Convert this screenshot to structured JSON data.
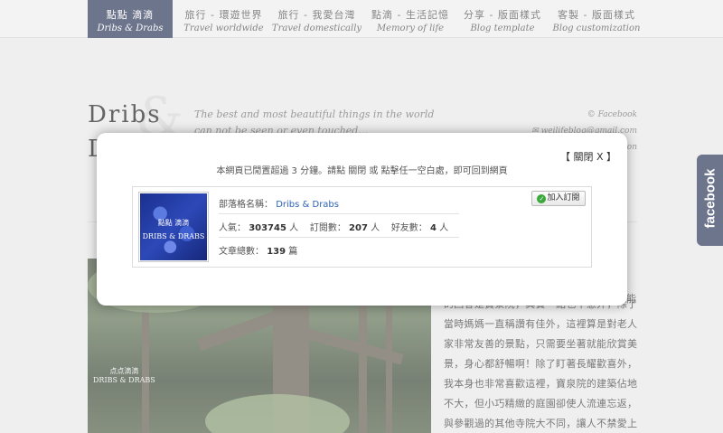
{
  "nav": {
    "items": [
      {
        "zh": "點點 滴滴",
        "en": "Dribs & Drabs"
      },
      {
        "zh": "旅行 - 環遊世界",
        "en": "Travel worldwide"
      },
      {
        "zh": "旅行 - 我愛台灣",
        "en": "Travel domestically"
      },
      {
        "zh": "點滴 - 生活記憶",
        "en": "Memory of life"
      },
      {
        "zh": "分享 - 版面樣式",
        "en": "Blog template"
      },
      {
        "zh": "客製 - 版面樣式",
        "en": "Blog customization"
      }
    ]
  },
  "header": {
    "logo_line1": "Dribs",
    "logo_amp": "&",
    "logo_line2": "D",
    "tagline1": "The best and most beautiful things in the world",
    "tagline2": "can not be seen or even touched...",
    "facebook_link": "© Facebook",
    "email_link": "✉ weilifeblog@gmail.com",
    "third_link": "on"
  },
  "photo": {
    "caption1": "点点滴滴",
    "caption2": "DRIBS & DRABS"
  },
  "article": {
    "text": "的回答是寶景院，其實一點也不意外，除了當時媽媽一直稱讚有佳外，這裡算是對老人家非常友善的景點，只需要坐著就能欣賞美景，身心都舒暢啊！除了盯著長耀歡喜外，我本身也非常喜歡這裡，寶泉院的建築佔地不大，但小巧精緻的庭園卻使人流連忘返，與參觀過的其他寺院大不同，讓人不禁愛上這裡■",
    "edge_char": "能"
  },
  "modal": {
    "close_label": "【 關閉 X 】",
    "message": "本網頁已閒置超過 3 分鐘。請點 關閉 或 點擊任一空白處，即可回到網頁",
    "blog": {
      "name_label": "部落格名稱：",
      "name_value": "Dribs & Drabs",
      "popularity_label": "人氣：",
      "popularity_value": "303745",
      "popularity_unit": "人",
      "subscribers_label": "訂閱數：",
      "subscribers_value": "207",
      "subscribers_unit": "人",
      "friends_label": "好友數：",
      "friends_value": "4",
      "friends_unit": "人",
      "articles_label": "文章總數：",
      "articles_value": "139",
      "articles_unit": "篇",
      "subscribe_label": "加入訂閱",
      "thumb_line1": "點點 滴滴",
      "thumb_line2": "DRIBS & DRABS"
    }
  },
  "facebook_tab": "facebook",
  "colors": {
    "nav_active": "#1e2b4d",
    "link": "#2e62b5",
    "subscribe_check": "#3aa83a"
  }
}
